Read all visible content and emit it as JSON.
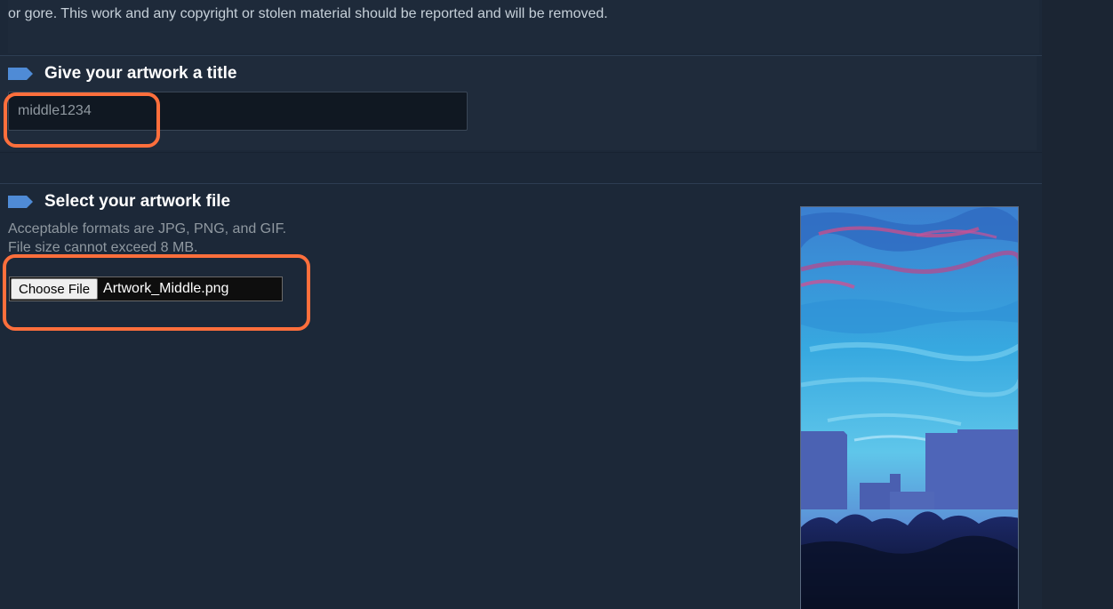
{
  "notice": {
    "text": "or gore. This work and any copyright or stolen material should be reported and will be removed."
  },
  "title_section": {
    "heading": "Give your artwork a title",
    "input_value": "middle1234"
  },
  "file_section": {
    "heading": "Select your artwork file",
    "hint_formats": "Acceptable formats are JPG, PNG, and GIF.",
    "hint_size": "File size cannot exceed 8 MB.",
    "choose_button_label": "Choose File",
    "file_name": "Artwork_Middle.png"
  },
  "icons": {
    "section_marker": "tag-icon"
  },
  "colors": {
    "accent_blue": "#4f8bd6",
    "highlight_orange": "#ff6f3c",
    "background": "#1b2838"
  }
}
